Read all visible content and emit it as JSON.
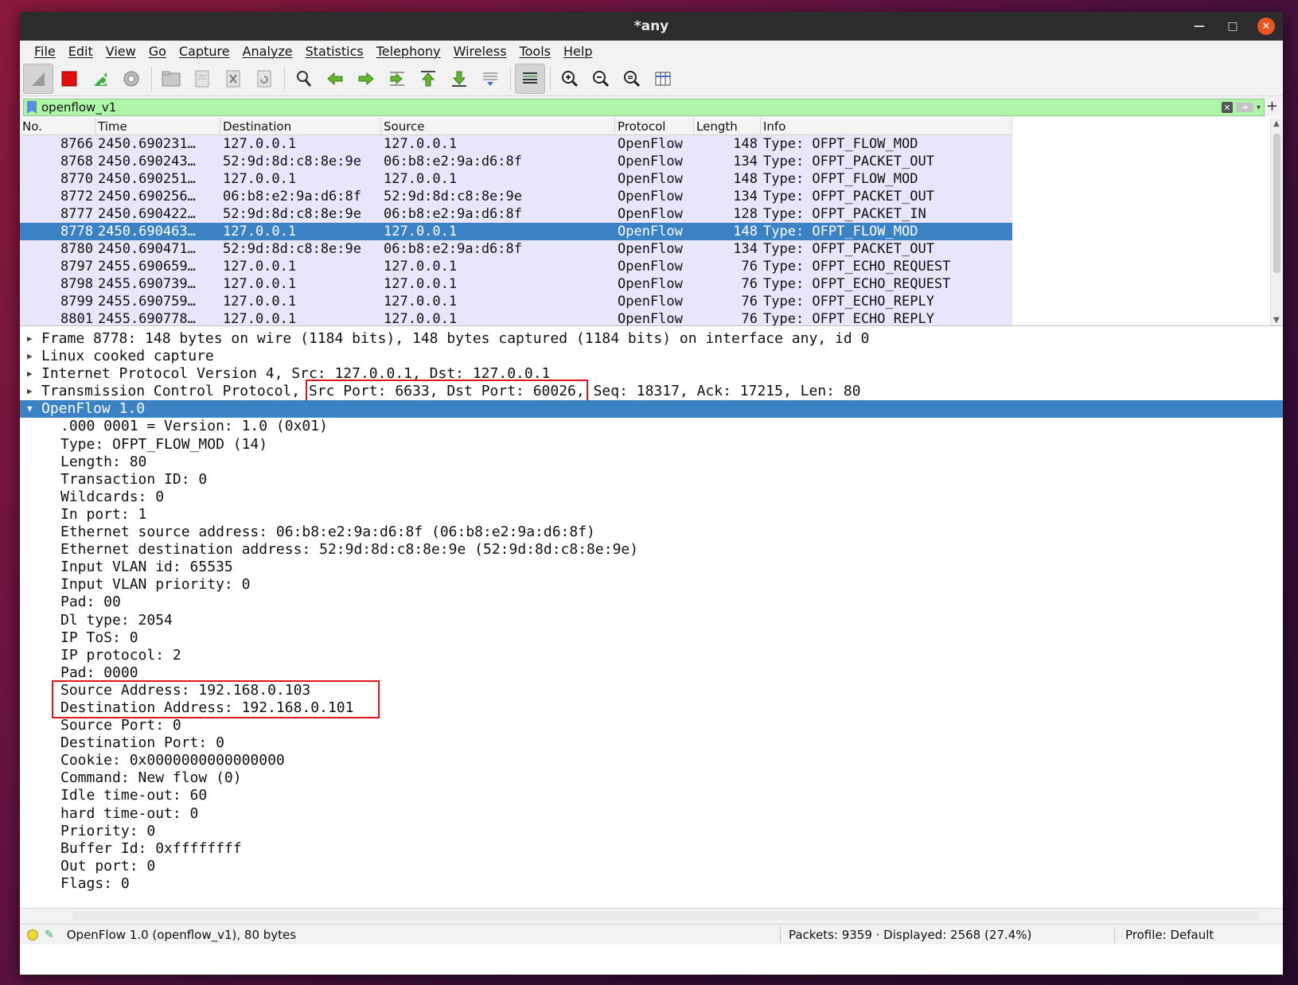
{
  "window": {
    "title": "*any"
  },
  "menu": [
    "File",
    "Edit",
    "View",
    "Go",
    "Capture",
    "Analyze",
    "Statistics",
    "Telephony",
    "Wireless",
    "Tools",
    "Help"
  ],
  "toolbar": {
    "icons": [
      "shark-fin-start-icon",
      "stop-capture-icon",
      "restart-capture-icon",
      "capture-options-icon",
      "open-file-icon",
      "save-file-icon",
      "close-file-icon",
      "reload-file-icon",
      "find-packet-icon",
      "go-back-icon",
      "go-forward-icon",
      "go-to-packet-icon",
      "go-first-icon",
      "go-last-icon",
      "autoscroll-icon",
      "colorize-icon",
      "zoom-in-icon",
      "zoom-out-icon",
      "zoom-normal-icon",
      "resize-columns-icon"
    ]
  },
  "filter": {
    "value": "openflow_v1"
  },
  "packet_list": {
    "columns": [
      "No.",
      "Time",
      "Destination",
      "Source",
      "Protocol",
      "Length",
      "Info"
    ],
    "rows": [
      {
        "no": "8766",
        "time": "2450.690231…",
        "dst": "127.0.0.1",
        "src": "127.0.0.1",
        "proto": "OpenFlow",
        "len": "148",
        "info": "Type: OFPT_FLOW_MOD"
      },
      {
        "no": "8768",
        "time": "2450.690243…",
        "dst": "52:9d:8d:c8:8e:9e",
        "src": "06:b8:e2:9a:d6:8f",
        "proto": "OpenFlow",
        "len": "134",
        "info": "Type: OFPT_PACKET_OUT"
      },
      {
        "no": "8770",
        "time": "2450.690251…",
        "dst": "127.0.0.1",
        "src": "127.0.0.1",
        "proto": "OpenFlow",
        "len": "148",
        "info": "Type: OFPT_FLOW_MOD"
      },
      {
        "no": "8772",
        "time": "2450.690256…",
        "dst": "06:b8:e2:9a:d6:8f",
        "src": "52:9d:8d:c8:8e:9e",
        "proto": "OpenFlow",
        "len": "134",
        "info": "Type: OFPT_PACKET_OUT"
      },
      {
        "no": "8777",
        "time": "2450.690422…",
        "dst": "52:9d:8d:c8:8e:9e",
        "src": "06:b8:e2:9a:d6:8f",
        "proto": "OpenFlow",
        "len": "128",
        "info": "Type: OFPT_PACKET_IN"
      },
      {
        "no": "8778",
        "time": "2450.690463…",
        "dst": "127.0.0.1",
        "src": "127.0.0.1",
        "proto": "OpenFlow",
        "len": "148",
        "info": "Type: OFPT_FLOW_MOD"
      },
      {
        "no": "8780",
        "time": "2450.690471…",
        "dst": "52:9d:8d:c8:8e:9e",
        "src": "06:b8:e2:9a:d6:8f",
        "proto": "OpenFlow",
        "len": "134",
        "info": "Type: OFPT_PACKET_OUT"
      },
      {
        "no": "8797",
        "time": "2455.690659…",
        "dst": "127.0.0.1",
        "src": "127.0.0.1",
        "proto": "OpenFlow",
        "len": "76",
        "info": "Type: OFPT_ECHO_REQUEST"
      },
      {
        "no": "8798",
        "time": "2455.690739…",
        "dst": "127.0.0.1",
        "src": "127.0.0.1",
        "proto": "OpenFlow",
        "len": "76",
        "info": "Type: OFPT_ECHO_REQUEST"
      },
      {
        "no": "8799",
        "time": "2455.690759…",
        "dst": "127.0.0.1",
        "src": "127.0.0.1",
        "proto": "OpenFlow",
        "len": "76",
        "info": "Type: OFPT_ECHO_REPLY"
      },
      {
        "no": "8801",
        "time": "2455.690778…",
        "dst": "127.0.0.1",
        "src": "127.0.0.1",
        "proto": "OpenFlow",
        "len": "76",
        "info": "Type: OFPT_ECHO_REPLY"
      }
    ]
  },
  "details": {
    "top_items": [
      "Frame 8778: 148 bytes on wire (1184 bits), 148 bytes captured (1184 bits) on interface any, id 0",
      "Linux cooked capture",
      "Internet Protocol Version 4, Src: 127.0.0.1, Dst: 127.0.0.1"
    ],
    "tcp": {
      "prefix": "Transmission Control Protocol, ",
      "ports": "Src Port: 6633, Dst Port: 60026,",
      "suffix": " Seq: 18317, Ack: 17215, Len: 80"
    },
    "openflow_title": "OpenFlow 1.0",
    "openflow_fields": [
      ".000 0001 = Version: 1.0 (0x01)",
      "Type: OFPT_FLOW_MOD (14)",
      "Length: 80",
      "Transaction ID: 0",
      "Wildcards: 0",
      "In port: 1",
      "Ethernet source address: 06:b8:e2:9a:d6:8f (06:b8:e2:9a:d6:8f)",
      "Ethernet destination address: 52:9d:8d:c8:8e:9e (52:9d:8d:c8:8e:9e)",
      "Input VLAN id: 65535",
      "Input VLAN priority: 0",
      "Pad: 00",
      "Dl type: 2054",
      "IP ToS: 0",
      "IP protocol: 2",
      "Pad: 0000",
      "Source Address: 192.168.0.103",
      "Destination Address: 192.168.0.101",
      "Source Port: 0",
      "Destination Port: 0",
      "Cookie: 0x0000000000000000",
      "Command: New flow (0)",
      "Idle time-out: 60",
      "hard time-out: 0",
      "Priority: 0",
      "Buffer Id: 0xffffffff",
      "Out port: 0",
      "Flags: 0"
    ]
  },
  "status": {
    "main": "OpenFlow 1.0 (openflow_v1), 80 bytes",
    "packets": "Packets: 9359 · Displayed: 2568 (27.4%)",
    "profile": "Profile: Default"
  },
  "colors": {
    "selection": "#3a82c4",
    "row_bg": "#e8e6fa",
    "filter_ok": "#aff5a8",
    "highlight_box": "#e0161e"
  }
}
